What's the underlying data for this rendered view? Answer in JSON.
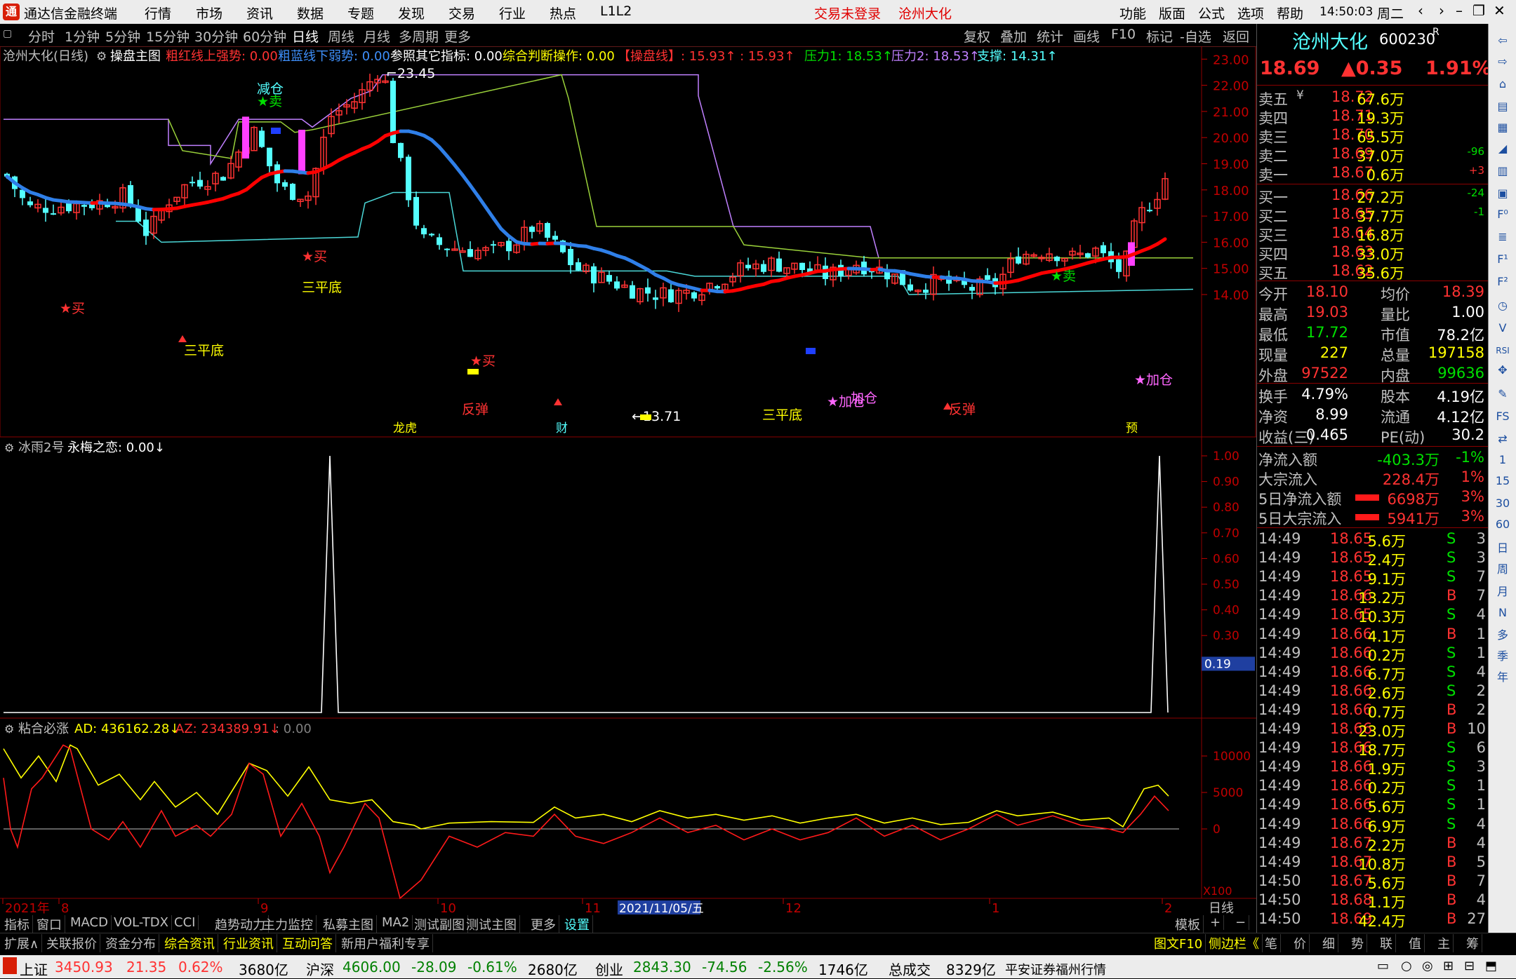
{
  "titlebar": {
    "logo": "通",
    "app_title": "通达信金融终端",
    "menus": [
      "行情",
      "市场",
      "资讯",
      "数据",
      "专题",
      "发现",
      "交易",
      "行业",
      "热点",
      "L1L2"
    ],
    "login_status": "交易未登录",
    "stock_name": "沧州大化",
    "right_menus": [
      "功能",
      "版面",
      "公式",
      "选项",
      "帮助"
    ],
    "time": "14:50:03",
    "weekday": "周二"
  },
  "periodbar": {
    "periods": [
      "分时",
      "1分钟",
      "5分钟",
      "15分钟",
      "30分钟",
      "60分钟",
      "日线",
      "周线",
      "月线",
      "多周期",
      "更多"
    ],
    "active": "日线",
    "tools": [
      "复权",
      "叠加",
      "统计",
      "画线",
      "F10",
      "标记",
      "-自选",
      "返回"
    ]
  },
  "main_chart": {
    "header": {
      "name": "沧州大化(日线)",
      "formula": "操盘主图",
      "red_label": "粗红线上强势: 0.00",
      "blue_label": "粗蓝线下弱势: 0.00",
      "ref_label": "参照其它指标: 0.00",
      "judge_label": "综合判断操作: 0.00",
      "op_label": "【操盘线】: 15.93↑ : 15.93↑",
      "pressure1": "压力1: 18.53↑",
      "pressure2": "压力2: 18.53↑",
      "support": "支撑: 14.31↑"
    },
    "y_ticks": [
      "23.00",
      "22.00",
      "21.00",
      "20.00",
      "19.00",
      "18.00",
      "17.00",
      "16.00",
      "15.00",
      "14.00"
    ],
    "annotations": {
      "high": "23.45",
      "low": "13.71",
      "reduce": "减仓",
      "sell_star": "★卖",
      "buy": "★买",
      "three_bottom": "三平底",
      "rebound": "反弹",
      "add": "★加仓",
      "add2": "加仓",
      "ranking": "龙虎",
      "finance": "财",
      "forecast": "预"
    }
  },
  "indicator1": {
    "name": "冰雨2号",
    "label": "永梅之恋: 0.00↓",
    "y_ticks": [
      "1.00",
      "0.90",
      "0.80",
      "0.70",
      "0.60",
      "0.50",
      "0.40",
      "0.30"
    ],
    "current": "0.19"
  },
  "indicator2": {
    "name": "粘合必涨",
    "ad": "AD: 436162.28↓",
    "az": "AZ: 234389.91↓",
    "zero": ": 0.00",
    "y_ticks": [
      "10000",
      "5000",
      "0"
    ],
    "scale": "X100"
  },
  "x_axis": {
    "labels": [
      "2021年",
      "8",
      "9",
      "10",
      "11",
      "12",
      "1",
      "2"
    ],
    "cursor_date": "2021/11/05/五",
    "period": "日线"
  },
  "quote": {
    "name": "沧州大化",
    "code": "600230",
    "suffix": "R",
    "price": "18.69",
    "change": "▲0.35",
    "change_pct": "1.91%",
    "asks": [
      {
        "label": "卖五",
        "mark": "¥",
        "price": "18.72",
        "vol": "67.6万",
        "diff": ""
      },
      {
        "label": "卖四",
        "mark": "",
        "price": "18.71",
        "vol": "19.3万",
        "diff": ""
      },
      {
        "label": "卖三",
        "mark": "",
        "price": "18.70",
        "vol": "65.5万",
        "diff": ""
      },
      {
        "label": "卖二",
        "mark": "",
        "price": "18.69",
        "vol": "37.0万",
        "diff": "-96"
      },
      {
        "label": "卖一",
        "mark": "",
        "price": "18.67",
        "vol": "0.6万",
        "diff": "+3"
      }
    ],
    "bids": [
      {
        "label": "买一",
        "price": "18.66",
        "vol": "27.2万",
        "diff": "-24"
      },
      {
        "label": "买二",
        "price": "18.65",
        "vol": "37.7万",
        "diff": "-1"
      },
      {
        "label": "买三",
        "price": "18.64",
        "vol": "16.8万",
        "diff": ""
      },
      {
        "label": "买四",
        "price": "18.63",
        "vol": "33.0万",
        "diff": ""
      },
      {
        "label": "买五",
        "price": "18.62",
        "vol": "35.6万",
        "diff": ""
      }
    ],
    "stats1": [
      [
        "今开",
        "18.10",
        "均价",
        "18.39"
      ],
      [
        "最高",
        "19.03",
        "量比",
        "1.00"
      ],
      [
        "最低",
        "17.72",
        "市值",
        "78.2亿"
      ],
      [
        "现量",
        "227",
        "总量",
        "197158"
      ],
      [
        "外盘",
        "97522",
        "内盘",
        "99636"
      ]
    ],
    "stats2": [
      [
        "换手",
        "4.79%",
        "股本",
        "4.19亿"
      ],
      [
        "净资",
        "8.99",
        "流通",
        "4.12亿"
      ],
      [
        "收益(三)",
        "0.465",
        "PE(动)",
        "30.2"
      ]
    ],
    "flows": [
      [
        "净流入额",
        "-403.3万",
        "-1%"
      ],
      [
        "大宗流入",
        "228.4万",
        "1%"
      ],
      [
        "5日净流入额",
        "6698万",
        "3%"
      ],
      [
        "5日大宗流入",
        "5941万",
        "3%"
      ]
    ],
    "ticks": [
      [
        "14:49",
        "18.65",
        "5.6万",
        "S",
        "3"
      ],
      [
        "14:49",
        "18.65",
        "2.4万",
        "S",
        "3"
      ],
      [
        "14:49",
        "18.65",
        "9.1万",
        "S",
        "7"
      ],
      [
        "14:49",
        "18.66",
        "13.2万",
        "B",
        "7"
      ],
      [
        "14:49",
        "18.65",
        "10.3万",
        "S",
        "4"
      ],
      [
        "14:49",
        "18.66",
        "4.1万",
        "B",
        "1"
      ],
      [
        "14:49",
        "18.66",
        "0.2万",
        "S",
        "1"
      ],
      [
        "14:49",
        "18.66",
        "6.7万",
        "S",
        "4"
      ],
      [
        "14:49",
        "18.66",
        "2.6万",
        "S",
        "2"
      ],
      [
        "14:49",
        "18.66",
        "0.7万",
        "B",
        "2"
      ],
      [
        "14:49",
        "18.66",
        "23.0万",
        "B",
        "10"
      ],
      [
        "14:49",
        "18.66",
        "18.7万",
        "S",
        "6"
      ],
      [
        "14:49",
        "18.66",
        "1.9万",
        "S",
        "3"
      ],
      [
        "14:49",
        "18.66",
        "0.2万",
        "S",
        "1"
      ],
      [
        "14:49",
        "18.66",
        "5.6万",
        "S",
        "1"
      ],
      [
        "14:49",
        "18.66",
        "6.9万",
        "S",
        "4"
      ],
      [
        "14:49",
        "18.67",
        "2.2万",
        "B",
        "4"
      ],
      [
        "14:49",
        "18.67",
        "10.8万",
        "B",
        "5"
      ],
      [
        "14:50",
        "18.67",
        "5.6万",
        "B",
        "7"
      ],
      [
        "14:50",
        "18.68",
        "1.1万",
        "B",
        "4"
      ],
      [
        "14:50",
        "18.69",
        "42.4万",
        "B",
        "27"
      ]
    ]
  },
  "tabs1": [
    "指标",
    "窗口",
    "MACD",
    "VOL-TDX",
    "CCI",
    "趋势动力",
    "主力监控",
    "私募主图",
    "MA2",
    "测试副图",
    "测试主图",
    "更多",
    "设置"
  ],
  "tabs1_right": [
    "模板",
    "+",
    "−"
  ],
  "tabs2": [
    "扩展∧",
    "关联报价",
    "资金分布",
    "综合资讯",
    "行业资讯",
    "互动问答",
    "新用户福利专享"
  ],
  "tabs2_right": [
    "图文F10",
    "侧边栏《"
  ],
  "side_tabs": [
    "笔",
    "价",
    "细",
    "势",
    "联",
    "值",
    "主",
    "筹"
  ],
  "status": {
    "sh_name": "上证",
    "sh_val": "3450.93",
    "sh_chg": "21.35",
    "sh_pct": "0.62%",
    "sh_amt": "3680亿",
    "hs_name": "沪深",
    "hs_val": "4606.00",
    "hs_chg": "-28.09",
    "hs_pct": "-0.61%",
    "hs_amt": "2680亿",
    "cy_name": "创业",
    "cy_val": "2843.30",
    "cy_chg": "-74.56",
    "cy_pct": "-2.56%",
    "cy_amt": "1746亿",
    "total_label": "总成交",
    "total_val": "8329亿",
    "broker": "平安证券福州行情"
  },
  "icons": [
    "back-arrow-icon",
    "forward-arrow-icon",
    "home-icon",
    "report-icon",
    "grid-icon",
    "chart-icon",
    "candle-icon",
    "table-icon",
    "f10-icon",
    "list-icon",
    "f1-icon",
    "f2-icon",
    "clock-icon",
    "vol-icon",
    "rsi-icon",
    "move-icon",
    "pen-icon",
    "fs-icon",
    "share-icon",
    "1-icon",
    "15-icon",
    "30-icon",
    "60-icon",
    "day-icon",
    "week-icon",
    "month-icon",
    "n-icon",
    "multi-icon",
    "season-icon",
    "year-icon"
  ],
  "colors": {
    "up": "#ff3232",
    "down": "#54ffff",
    "ma_red": "#ff0000",
    "ma_blue": "#2f7fe8",
    "grid": "#8b0000",
    "axis": "#c00000"
  }
}
